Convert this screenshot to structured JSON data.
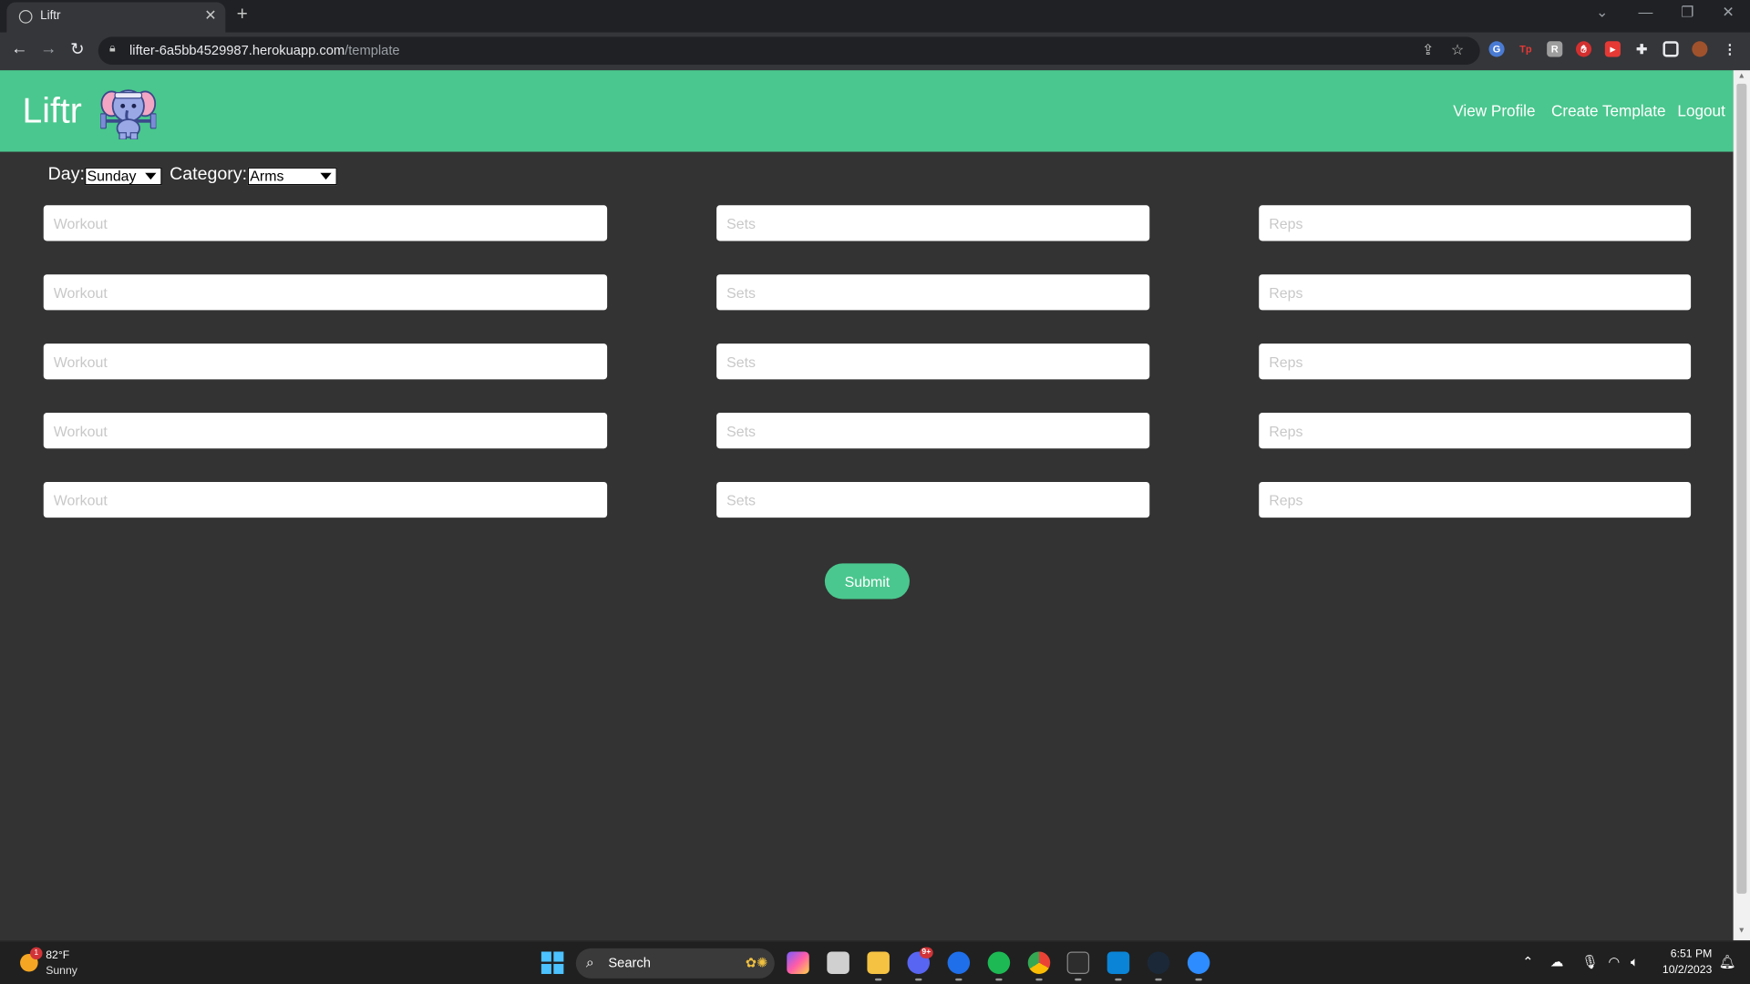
{
  "browser": {
    "tab_title": "Liftr",
    "tab_close": "✕",
    "new_tab": "+",
    "url_host": "lifter-6a5bb4529987.herokuapp.com",
    "url_path": "/template"
  },
  "app": {
    "brand": "Liftr",
    "nav": {
      "view_profile": "View Profile",
      "create_template": "Create Template",
      "logout": "Logout"
    },
    "brand_color": "#4ac78e",
    "background_color": "#333333"
  },
  "filters": {
    "day_label": "Day:",
    "day_value": "Sunday",
    "category_label": "Category:",
    "category_value": "Arms"
  },
  "placeholders": {
    "workout": "Workout",
    "sets": "Sets",
    "reps": "Reps"
  },
  "submit_label": "Submit",
  "taskbar": {
    "weather_temp": "82°F",
    "weather_condition": "Sunny",
    "weather_badge": "1",
    "search_label": "Search",
    "time": "6:51 PM",
    "date": "10/2/2023",
    "discord_badge": "9+"
  }
}
